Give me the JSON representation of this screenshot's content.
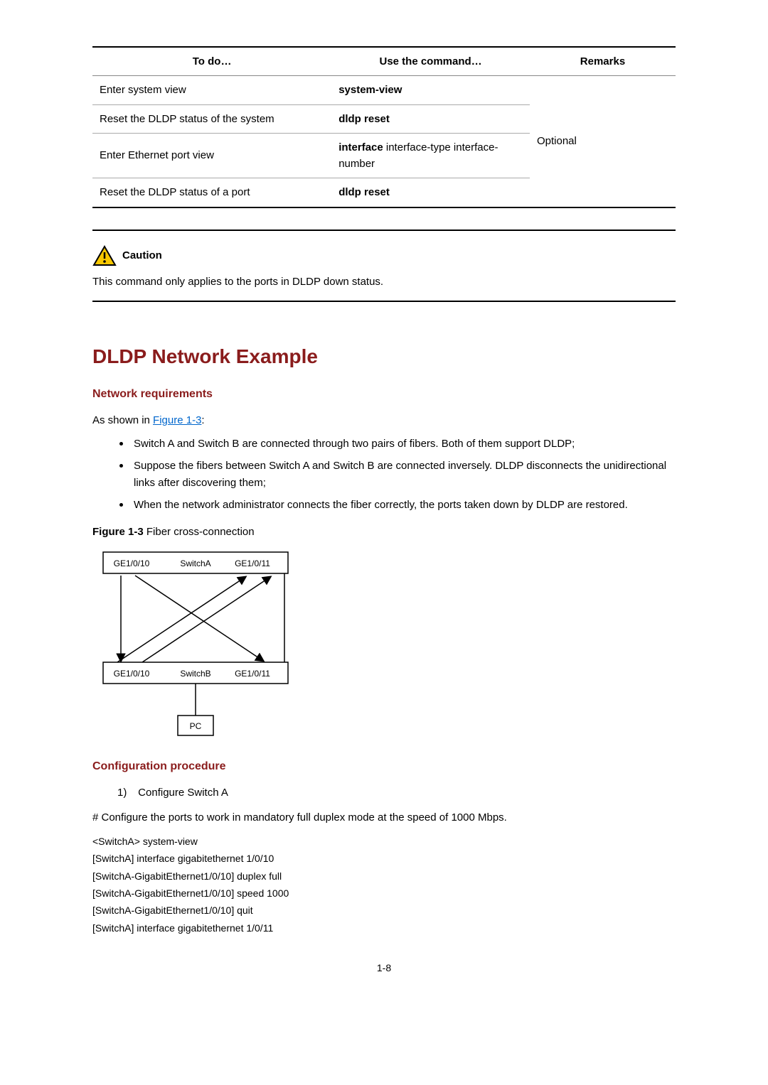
{
  "table": {
    "headers": {
      "c1": "To do…",
      "c2": "Use the command…",
      "c3": "Remarks"
    },
    "rows": {
      "r1": {
        "todo": "Enter system view",
        "cmd_bold": "system-view"
      },
      "r2": {
        "todo": "Reset the DLDP status of the system",
        "cmd_bold": "dldp reset"
      },
      "r3": {
        "todo": "Enter Ethernet port view",
        "cmd_bold": "interface",
        "cmd_plain": " interface-type interface-number"
      },
      "r4": {
        "todo": "Reset the DLDP status of a port",
        "cmd_bold": "dldp reset"
      },
      "remarks": "Optional"
    }
  },
  "caution": {
    "label": "Caution",
    "text": "This command only applies to the ports in DLDP down status."
  },
  "section_title": "DLDP Network Example",
  "net_req_heading": "Network requirements",
  "intro_prefix": "As shown in ",
  "intro_link": "Figure 1-3",
  "intro_suffix": ":",
  "bullets": {
    "b1": "Switch A and Switch B are connected through two pairs of fibers. Both of them support DLDP;",
    "b2": "Suppose the fibers between Switch A and Switch B are connected inversely. DLDP disconnects the unidirectional links after discovering them;",
    "b3": "When the network administrator connects the fiber correctly, the ports taken down by DLDP are restored."
  },
  "figure": {
    "label": "Figure 1-3",
    "caption": " Fiber cross-connection",
    "switchA": {
      "port1": "GE1/0/10",
      "name": "SwitchA",
      "port2": "GE1/0/11"
    },
    "switchB": {
      "port1": "GE1/0/10",
      "name": "SwitchB",
      "port2": "GE1/0/11"
    },
    "pc": "PC"
  },
  "config_heading": "Configuration procedure",
  "step1_num": "1)",
  "step1_text": "Configure Switch A",
  "config_desc": "# Configure the ports to work in mandatory full duplex mode at the speed of 1000 Mbps.",
  "cli": {
    "l1": "<SwitchA> system-view",
    "l2": "[SwitchA] interface gigabitethernet 1/0/10",
    "l3": "[SwitchA-GigabitEthernet1/0/10] duplex full",
    "l4": "[SwitchA-GigabitEthernet1/0/10] speed 1000",
    "l5": "[SwitchA-GigabitEthernet1/0/10] quit",
    "l6": "[SwitchA] interface gigabitethernet 1/0/11"
  },
  "page_number": "1-8"
}
